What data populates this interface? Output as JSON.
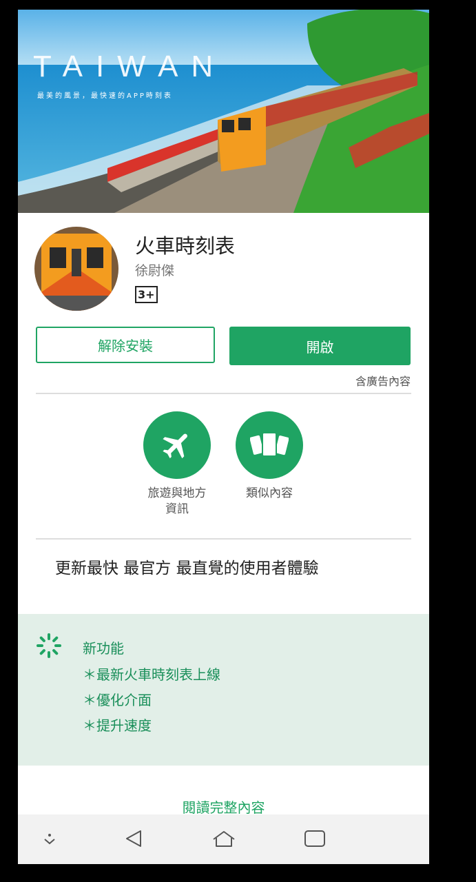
{
  "banner": {
    "title": "TAIWAN",
    "subtitle": "最美的風景，最快速的APP時刻表"
  },
  "app": {
    "title": "火車時刻表",
    "developer": "徐尉傑",
    "rating": "3+"
  },
  "actions": {
    "uninstall_label": "解除安裝",
    "open_label": "開啟",
    "ads_note": "含廣告內容"
  },
  "categories": [
    {
      "label_line1": "旅遊與地方",
      "label_line2": "資訊",
      "icon": "airplane-icon"
    },
    {
      "label_line1": "類似內容",
      "label_line2": "",
      "icon": "similar-cards-icon"
    }
  ],
  "description": "更新最快 最官方 最直覺的使用者體驗",
  "whats_new": {
    "title": "新功能",
    "items": [
      "＊最新火車時刻表上線",
      "＊優化介面",
      "＊提升速度"
    ]
  },
  "read_more_label": "閱讀完整內容",
  "colors": {
    "accent": "#1fa463",
    "whats_new_bg": "#e2efe8"
  }
}
